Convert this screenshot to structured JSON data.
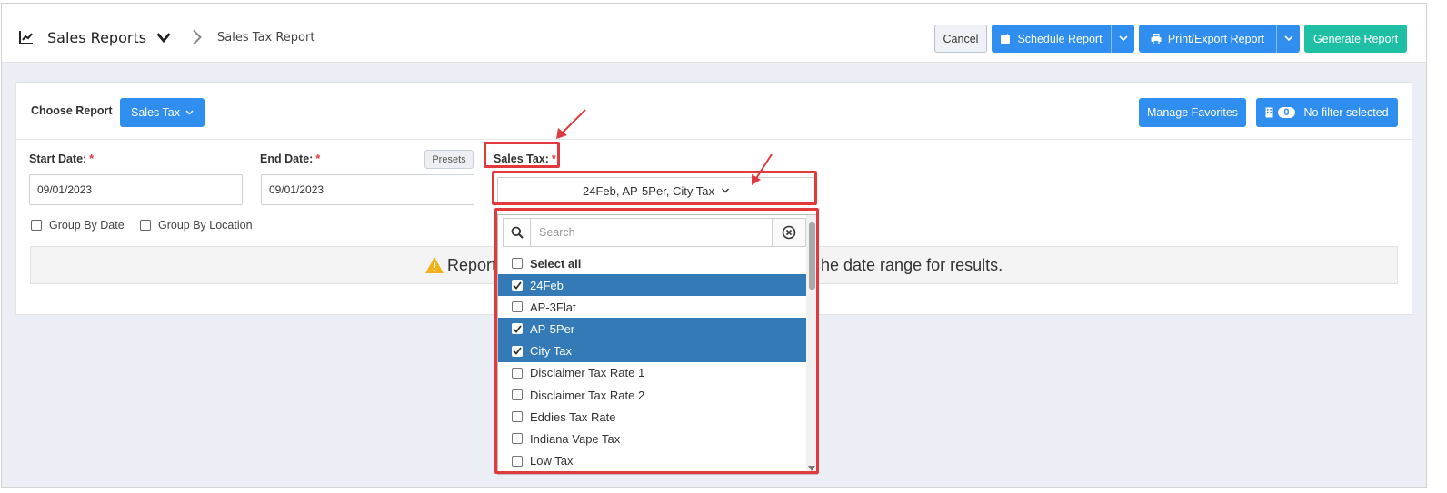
{
  "header": {
    "title": "Sales Reports",
    "breadcrumb": "Sales Tax Report",
    "cancel_label": "Cancel",
    "schedule_label": "Schedule Report",
    "print_label": "Print/Export Report",
    "generate_label": "Generate Report"
  },
  "report": {
    "choose_label": "Choose Report",
    "selected": "Sales Tax",
    "manage_favorites": "Manage Favorites",
    "filter_count": "0",
    "filter_label": "No filter selected"
  },
  "form": {
    "start_label": "Start Date:",
    "start_value": "09/01/2023",
    "end_label": "End Date:",
    "end_value": "09/01/2023",
    "presets_label": "Presets",
    "sales_tax_label": "Sales Tax:",
    "required_mark": "*",
    "group_by_date": "Group By Date",
    "group_by_location": "Group By Location",
    "sales_tax_selected": "24Feb, AP-5Per, City Tax"
  },
  "alert": {
    "text_left": "Report",
    "text_right": "he date range for results."
  },
  "dropdown": {
    "search_placeholder": "Search",
    "select_all": "Select all",
    "options": [
      {
        "label": "24Feb",
        "checked": true
      },
      {
        "label": "AP-3Flat",
        "checked": false
      },
      {
        "label": "AP-5Per",
        "checked": true
      },
      {
        "label": "City Tax",
        "checked": true
      },
      {
        "label": "Disclaimer Tax Rate 1",
        "checked": false
      },
      {
        "label": "Disclaimer Tax Rate 2",
        "checked": false
      },
      {
        "label": "Eddies Tax Rate",
        "checked": false
      },
      {
        "label": "Indiana Vape Tax",
        "checked": false
      },
      {
        "label": "Low Tax",
        "checked": false
      }
    ]
  },
  "colors": {
    "primary": "#2f8ef0",
    "success": "#1fbfa6",
    "selected_row": "#337ab7",
    "annotation": "#e0393e"
  }
}
